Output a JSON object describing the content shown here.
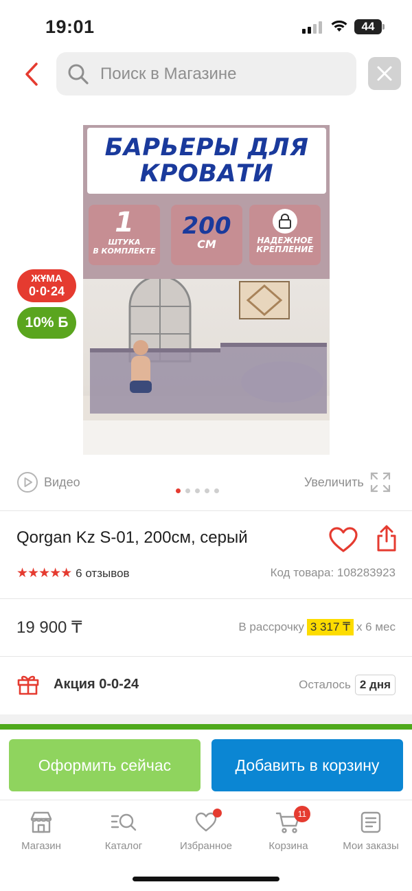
{
  "status_bar": {
    "time": "19:01",
    "battery": "44",
    "icons": [
      "signal-icon",
      "wifi-icon",
      "battery-icon"
    ]
  },
  "header": {
    "back_icon": "chevron-left-icon",
    "search_placeholder": "Поиск в Магазине",
    "search_icon": "search-icon",
    "close_icon": "close-icon"
  },
  "product_image": {
    "banner_line1": "БАРЬЕРЫ ДЛЯ",
    "banner_line2": "КРОВАТИ",
    "card1_big": "1",
    "card1_small_1": "ШТУКА",
    "card1_small_2": "В КОМПЛЕКТЕ",
    "card2_big": "200",
    "card2_unit": "СМ",
    "card3_small_1": "НАДЕЖНОЕ",
    "card3_small_2": "КРЕПЛЕНИЕ"
  },
  "badges": {
    "juma_label": "ЖҰМА",
    "juma_value": "0·0·24",
    "cashback": "10% Б"
  },
  "media": {
    "video_label": "Видео",
    "zoom_label": "Увеличить",
    "dots_count": 5,
    "active_dot": 0
  },
  "product": {
    "title": "Qorgan Kz S-01, 200см, серый",
    "stars": "★★★★★",
    "rating": 4.5,
    "reviews": "6 отзывов",
    "sku": "Код товара: 108283923"
  },
  "price": {
    "value": "19 900 ₸",
    "installment_prefix": "В рассрочку",
    "installment_amount": "3 317 ₸",
    "installment_suffix": "x 6 мес"
  },
  "promo": {
    "label": "Акция 0-0-24",
    "remain_label": "Осталось",
    "remain_value": "2 дня"
  },
  "cta": {
    "checkout": "Оформить сейчас",
    "add_to_cart": "Добавить в корзину"
  },
  "tabbar": {
    "items": [
      {
        "label": "Магазин",
        "icon": "store-icon"
      },
      {
        "label": "Каталог",
        "icon": "catalog-icon"
      },
      {
        "label": "Избранное",
        "icon": "heart-icon"
      },
      {
        "label": "Корзина",
        "icon": "cart-icon",
        "badge": "11"
      },
      {
        "label": "Мои заказы",
        "icon": "orders-icon"
      }
    ]
  },
  "colors": {
    "accent_red": "#e53b30",
    "green": "#4ea91b",
    "blue": "#0b86d3",
    "light_green": "#8fd45e",
    "highlight_yellow": "#fddc00"
  }
}
